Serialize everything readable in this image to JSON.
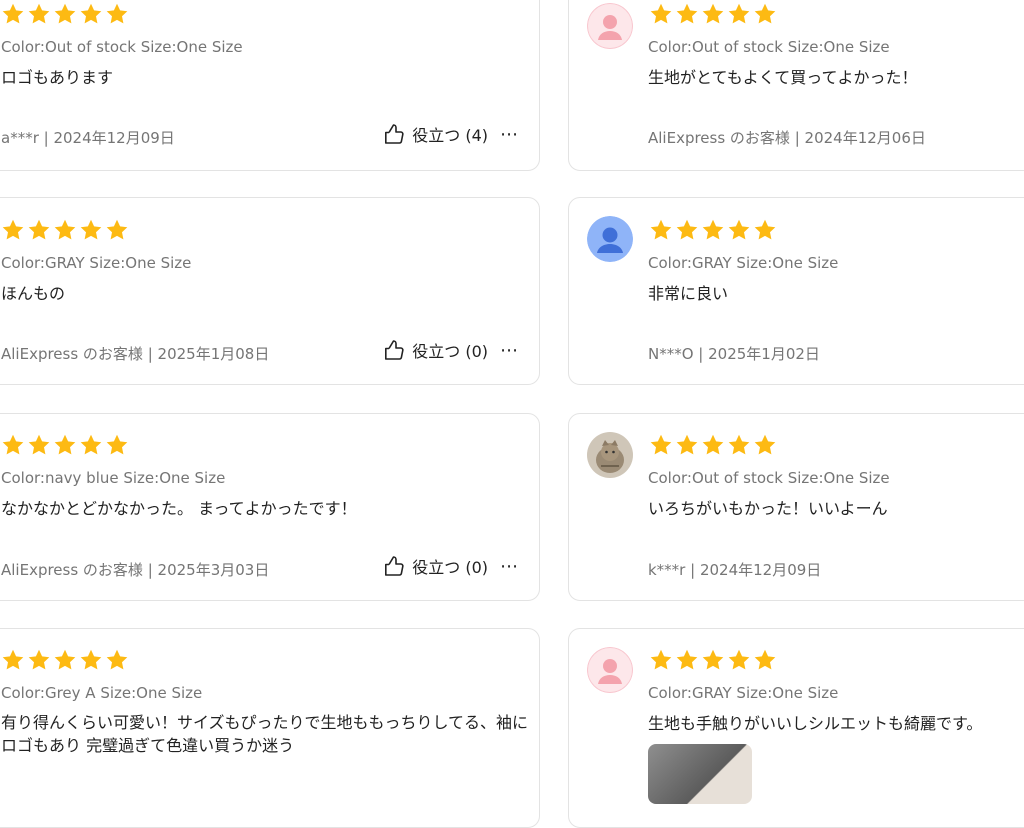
{
  "reviews": [
    {
      "meta": "Color:Out of stock Size:One Size",
      "text": "ロゴもあります",
      "footer": "a***r | 2024年12月09日",
      "helpful": "役立つ (4)",
      "avatar": "none"
    },
    {
      "meta": "Color:Out of stock Size:One Size",
      "text": "生地がとてもよくて買ってよかった！",
      "footer": "AliExpress のお客様 | 2024年12月06日",
      "helpful": "",
      "avatar": "pink-person-icon"
    },
    {
      "meta": "Color:GRAY Size:One Size",
      "text": "ほんもの",
      "footer": "AliExpress のお客様 | 2025年1月08日",
      "helpful": "役立つ (0)",
      "avatar": "none"
    },
    {
      "meta": "Color:GRAY Size:One Size",
      "text": "非常に良い",
      "footer": "N***O | 2025年1月02日",
      "helpful": "",
      "avatar": "blue-person-icon"
    },
    {
      "meta": "Color:navy blue Size:One Size",
      "text": "なかなかとどかなかった。 まってよかったです！",
      "footer": "AliExpress のお客様 | 2025年3月03日",
      "helpful": "役立つ (0)",
      "avatar": "none"
    },
    {
      "meta": "Color:Out of stock Size:One Size",
      "text": "いろちがいもかった！いいよーん",
      "footer": "k***r | 2024年12月09日",
      "helpful": "",
      "avatar": "cat-photo"
    },
    {
      "meta": "Color:Grey A Size:One Size",
      "text": "有り得んくらい可愛い！サイズもぴったりで生地ももっちりしてる、袖にロゴもあり 完璧過ぎて色違い買うか迷う",
      "footer": "",
      "helpful": "",
      "avatar": "none"
    },
    {
      "meta": "Color:GRAY Size:One Size",
      "text": "生地も手触りがいいしシルエットも綺麗です。",
      "footer": "",
      "helpful": "",
      "avatar": "pink-person-icon"
    }
  ],
  "rating_stars": 5,
  "colors": {
    "star": "#FDBA13",
    "meta_text": "#757575",
    "border": "#e3e3e3"
  }
}
